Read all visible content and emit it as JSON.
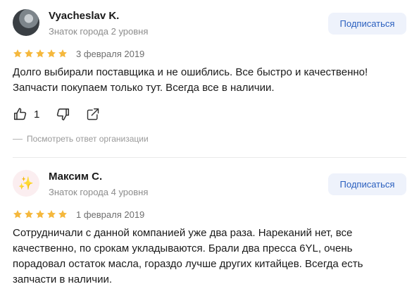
{
  "reviews": [
    {
      "author": "Vyacheslav K.",
      "level": "Знаток города 2 уровня",
      "subscribe_label": "Подписаться",
      "rating": 5,
      "date": "3 февраля 2019",
      "text": "Долго выбирали поставщика и не ошиблись. Все быстро и качественно! Запчасти покупаем только тут. Всегда все в наличии.",
      "likes": "1",
      "org_answer_label": "Посмотреть ответ организации"
    },
    {
      "author": "Максим С.",
      "level": "Знаток города 4 уровня",
      "subscribe_label": "Подписаться",
      "avatar_emoji": "✨",
      "rating": 5,
      "date": "1 февраля 2019",
      "text": "Сотрудничали с данной компанией уже два раза. Нареканий нет, все качественно, по срокам укладываются. Брали два пресса 6YL, очень порадовал остаток масла, гораздо лучше других китайцев. Всегда есть запчасти в наличии."
    }
  ],
  "colors": {
    "star": "#f5b83d",
    "subscribe_bg": "#eef2fb",
    "subscribe_text": "#2a5fbf"
  }
}
